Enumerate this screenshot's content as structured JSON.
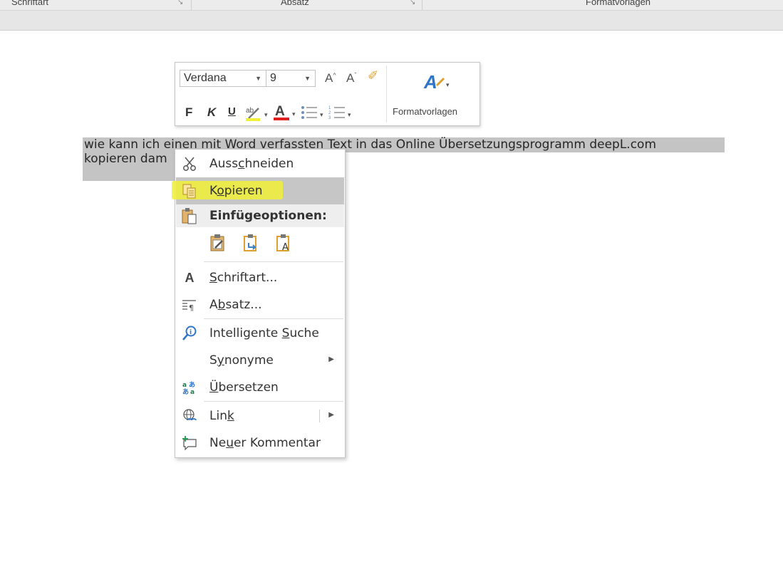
{
  "ribbon": {
    "groups": [
      "Schriftart",
      "Absatz",
      "Formatvorlagen"
    ]
  },
  "mini_toolbar": {
    "font_name": "Verdana",
    "font_size": "9",
    "bold": "F",
    "italic": "K",
    "underline": "U",
    "styles_label": "Formatvorlagen"
  },
  "document": {
    "line1": "wie kann ich einen mit Word verfassten Text in das Online Übersetzungsprogramm deepL.com",
    "line2": "kopieren dam"
  },
  "context_menu": {
    "items": [
      {
        "pre": "Auss",
        "u": "c",
        "post": "hneiden",
        "icon": "scissors-icon"
      },
      {
        "pre": "K",
        "u": "o",
        "post": "pieren",
        "icon": "copy-icon"
      },
      {
        "label": "Einfügeoptionen:",
        "icon": "paste-icon"
      },
      {
        "pre": "",
        "u": "S",
        "post": "chriftart...",
        "icon": "font-icon"
      },
      {
        "pre": "A",
        "u": "b",
        "post": "satz...",
        "icon": "paragraph-icon"
      },
      {
        "pre": "Intelligente ",
        "u": "S",
        "post": "uche",
        "icon": "smart-lookup-icon"
      },
      {
        "pre": "S",
        "u": "y",
        "post": "nonyme",
        "icon": ""
      },
      {
        "pre": "",
        "u": "Ü",
        "post": "bersetzen",
        "icon": "translate-icon"
      },
      {
        "pre": "Lin",
        "u": "k",
        "post": "",
        "icon": "link-icon"
      },
      {
        "pre": "Ne",
        "u": "u",
        "post": "er Kommentar",
        "icon": "new-comment-icon"
      }
    ],
    "highlight_color": "#f0f037",
    "hover_color": "#c6c6c6"
  }
}
